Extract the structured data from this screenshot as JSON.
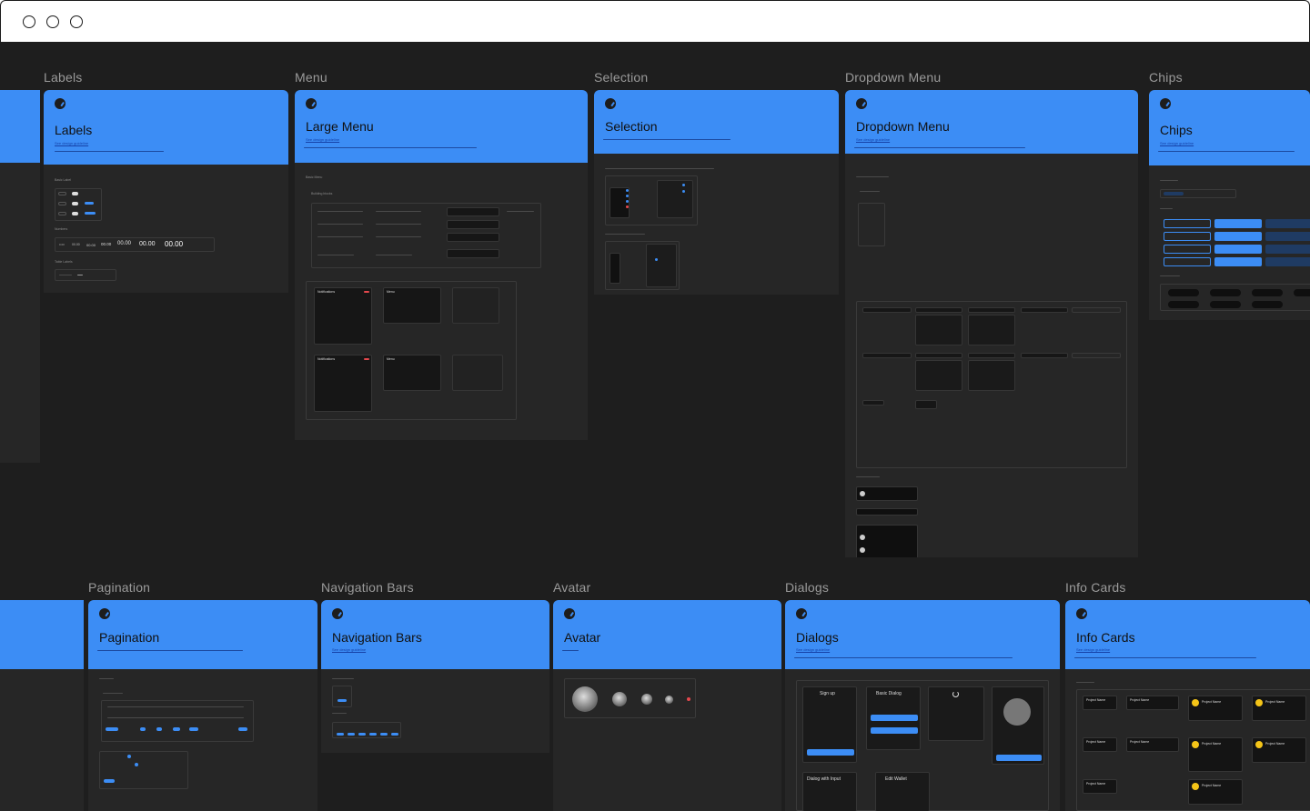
{
  "sections": {
    "labels": "Labels",
    "menu": "Menu",
    "selection": "Selection",
    "dropdown": "Dropdown Menu",
    "chips": "Chips",
    "pagination": "Pagination",
    "navbars": "Navigation Bars",
    "avatar": "Avatar",
    "dialogs": "Dialogs",
    "infocards": "Info Cards"
  },
  "frames": {
    "labels": {
      "title": "Labels",
      "link": "See design guideline"
    },
    "menu": {
      "title": "Large Menu",
      "link": "See design guideline"
    },
    "selection": {
      "title": "Selection"
    },
    "dropdown": {
      "title": "Dropdown Menu",
      "link": "See design guideline"
    },
    "chips": {
      "title": "Chips",
      "link": "See design guideline"
    },
    "pagination": {
      "title": "Pagination"
    },
    "navbars": {
      "title": "Navigation Bars",
      "link": "See design guideline"
    },
    "avatar": {
      "title": "Avatar"
    },
    "dialogs": {
      "title": "Dialogs",
      "link": "See design guideline"
    },
    "infocards": {
      "title": "Info Cards",
      "link": "See design guideline"
    }
  },
  "labels_frame": {
    "basic_label": "Basic Label",
    "numbers": "Numbers",
    "table_labels": "Table Labels",
    "number_samples": [
      "0.00",
      "00.00",
      "00.00",
      "00.00",
      "00.00",
      "00.00",
      "00.00"
    ]
  },
  "menu_frame": {
    "basic_menu": "Basic Menu",
    "building_blocks": "Building blocks",
    "notifications": "Notifications",
    "menu": "Menu"
  },
  "dialogs_frame": {
    "sign_up": "Sign up",
    "basic_dialog": "Basic Dialog",
    "dialog_with_input": "Dialog with Input",
    "edit_wallet": "Edit Wallet"
  },
  "infocards_frame": {
    "project_name": "Project Name"
  },
  "colors": {
    "accent": "#3c8df5",
    "canvas": "#1e1e1e",
    "frame": "#262626"
  }
}
